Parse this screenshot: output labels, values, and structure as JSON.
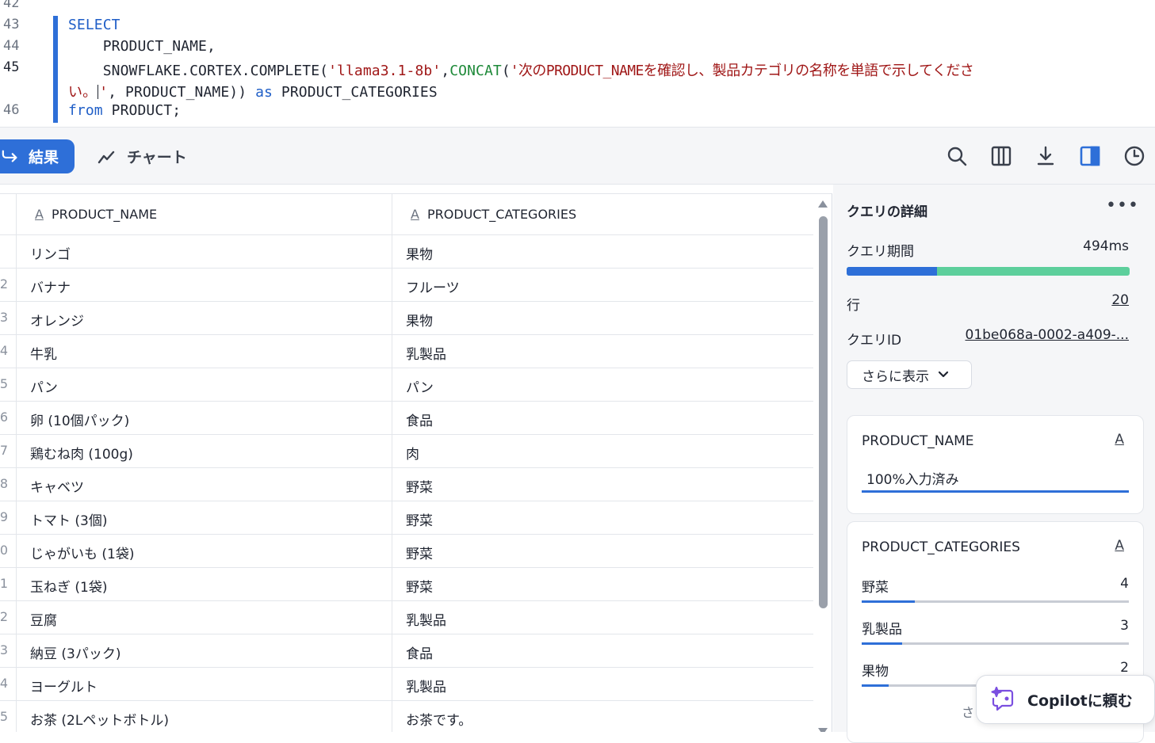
{
  "editor": {
    "line_numbers": [
      "42",
      "43",
      "44",
      "45",
      "46"
    ],
    "active_line": "45",
    "lines": {
      "l43_kw": "SELECT",
      "l44": "    PRODUCT_NAME,",
      "l45_a": "    SNOWFLAKE.CORTEX.COMPLETE(",
      "l45_str1": "'llama3.1-8b'",
      "l45_comma": ",",
      "l45_fn": "CONCAT",
      "l45_paren": "(",
      "l45_str2": "'次のPRODUCT_NAMEを確認し、製品カテゴリの名称を単語で示してくださ",
      "l45w_str": "い。",
      "l45w_str_end": "'",
      "l45w_rest": ", PRODUCT_NAME)) ",
      "l45w_kw": "as",
      "l45w_alias": " PRODUCT_CATEGORIES",
      "l46_kw": "from",
      "l46_rest": " PRODUCT;"
    }
  },
  "toolbar": {
    "results_tab": "結果",
    "chart_tab": "チャート",
    "icons": [
      "search-icon",
      "columns-icon",
      "download-icon",
      "side-panel-icon",
      "history-icon"
    ]
  },
  "grid": {
    "columns": [
      "PRODUCT_NAME",
      "PRODUCT_CATEGORIES"
    ],
    "column_type_glyph": "A",
    "rows": [
      {
        "n": "",
        "name": "リンゴ",
        "category": "果物"
      },
      {
        "n": "2",
        "name": "バナナ",
        "category": "フルーツ"
      },
      {
        "n": "3",
        "name": "オレンジ",
        "category": "果物"
      },
      {
        "n": "4",
        "name": "牛乳",
        "category": "乳製品"
      },
      {
        "n": "5",
        "name": "パン",
        "category": "パン"
      },
      {
        "n": "6",
        "name": "卵 (10個パック)",
        "category": "食品"
      },
      {
        "n": "7",
        "name": "鶏むね肉 (100g)",
        "category": "肉"
      },
      {
        "n": "8",
        "name": "キャベツ",
        "category": "野菜"
      },
      {
        "n": "9",
        "name": "トマト (3個)",
        "category": "野菜"
      },
      {
        "n": "0",
        "name": "じゃがいも (1袋)",
        "category": "野菜"
      },
      {
        "n": "1",
        "name": "玉ねぎ (1袋)",
        "category": "野菜"
      },
      {
        "n": "2",
        "name": "豆腐",
        "category": "乳製品"
      },
      {
        "n": "3",
        "name": "納豆 (3パック)",
        "category": "食品"
      },
      {
        "n": "4",
        "name": "ヨーグルト",
        "category": "乳製品"
      },
      {
        "n": "5",
        "name": "お茶 (2Lペットボトル)",
        "category": "お茶です。"
      }
    ]
  },
  "panel": {
    "title": "クエリの詳細",
    "more": "•••",
    "duration_label": "クエリ期間",
    "duration_value": "494ms",
    "duration_fraction_blue": 0.32,
    "rows_label": "行",
    "rows_value": "20",
    "query_id_label": "クエリID",
    "query_id_value": "01be068a-0002-a409-...",
    "show_more": "さらに表示",
    "name_card": {
      "title": "PRODUCT_NAME",
      "type": "A",
      "fill_text": "100%入力済み",
      "fill_fraction": 1.0
    },
    "cat_card": {
      "title": "PRODUCT_CATEGORIES",
      "type": "A",
      "items": [
        {
          "label": "野菜",
          "count": "4",
          "fraction": 0.2
        },
        {
          "label": "乳製品",
          "count": "3",
          "fraction": 0.15
        },
        {
          "label": "果物",
          "count": "2",
          "fraction": 0.1
        }
      ],
      "footer_peek": "さ"
    }
  },
  "copilot": {
    "label": "Copilotに頼む"
  },
  "colors": {
    "accent": "#2e6fd8",
    "accent_green": "#5dcf9c",
    "keyword": "#1f5ec7",
    "string": "#a01818",
    "function": "#1f8a3a"
  }
}
